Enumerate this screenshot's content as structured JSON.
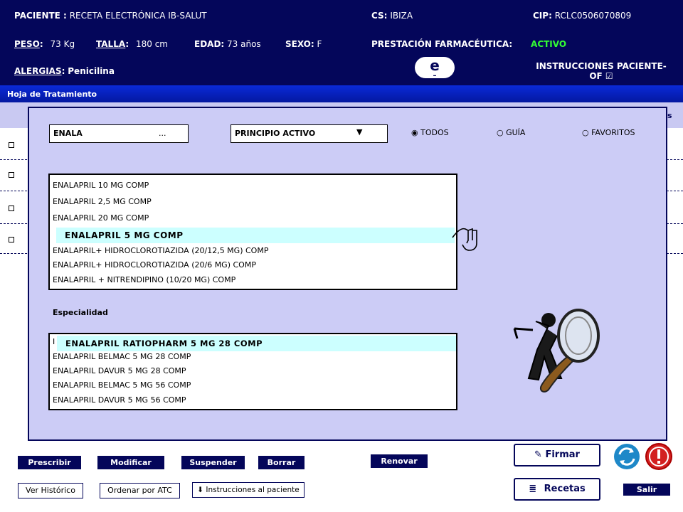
{
  "header": {
    "paciente_label": "PACIENTE :",
    "paciente_value": "RECETA ELECTRÓNICA IB-SALUT",
    "cs_label": "CS:",
    "cs_value": "IBIZA",
    "cip_label": "CIP:",
    "cip_value": "RCLC0506070809",
    "peso_label": "PESO",
    "peso_value": "73 Kg",
    "talla_label": "TALLA",
    "talla_value": "180 cm",
    "edad_label": "EDAD:",
    "edad_value": "73 años",
    "sexo_label": "SEXO:",
    "sexo_value": "F",
    "prestacion_label": "PRESTACIÓN FARMACÉUTICA:",
    "prestacion_value": "ACTIVO",
    "alergias_label": "ALERGIAS",
    "alergias_value": "Penicilina",
    "e_badge": "e",
    "e_sub": "–",
    "instrucciones_line1": "INSTRUCCIONES PACIENTE-",
    "instrucciones_line2": "OF ☑"
  },
  "treatment_bar": "Hoja de Tratamiento",
  "column_bar_fragment": "s",
  "modal": {
    "search_value": "ENALA",
    "search_ellipsis": "...",
    "filter_select": "PRINCIPIO ACTIVO",
    "radios": [
      {
        "label": "TODOS",
        "selected": true
      },
      {
        "label": "GUÍA",
        "selected": false
      },
      {
        "label": "FAVORITOS",
        "selected": false
      }
    ],
    "principios": [
      "ENALAPRIL 10 MG COMP",
      "ENALAPRIL 2,5 MG COMP",
      "ENALAPRIL 20 MG COMP",
      "ENALAPRIL 5 MG COMP",
      "ENALAPRIL+ HIDROCLOROTIAZIDA (20/12,5 MG) COMP",
      "ENALAPRIL+ HIDROCLOROTIAZIDA (20/6 MG) COMP",
      "ENALAPRIL + NITRENDIPINO (10/20 MG) COMP"
    ],
    "selected_principio": "ENALAPRIL 5 MG COMP",
    "especialidad_label": "Especialidad",
    "especialidades": [
      "ENALAPRIL RATIOPHARM 5 MG 28 COMP",
      "ENALAPRIL BELMAC 5 MG 28 COMP",
      "ENALAPRIL DAVUR 5 MG 28 COMP",
      "ENALAPRIL BELMAC 5 MG 56 COMP",
      "ENALAPRIL DAVUR 5 MG 56 COMP"
    ],
    "selected_especialidad": "ENALAPRIL RATIOPHARM 5 MG 28 COMP"
  },
  "buttons": {
    "prescribir": "Prescribir",
    "modificar": "Modificar",
    "suspender": "Suspender",
    "borrar": "Borrar",
    "renovar": "Renovar",
    "ver_historico": "Ver Histórico",
    "ordenar_atc": "Ordenar por ATC",
    "instrucciones_paciente": "Instrucciones al paciente",
    "firmar": "Firmar",
    "recetas": "Recetas",
    "salir": "Salir"
  },
  "colors": {
    "header_bg": "#04065a",
    "modal_bg": "#ccccf6",
    "highlight": "#ccffff",
    "status_active": "#33ff33"
  }
}
